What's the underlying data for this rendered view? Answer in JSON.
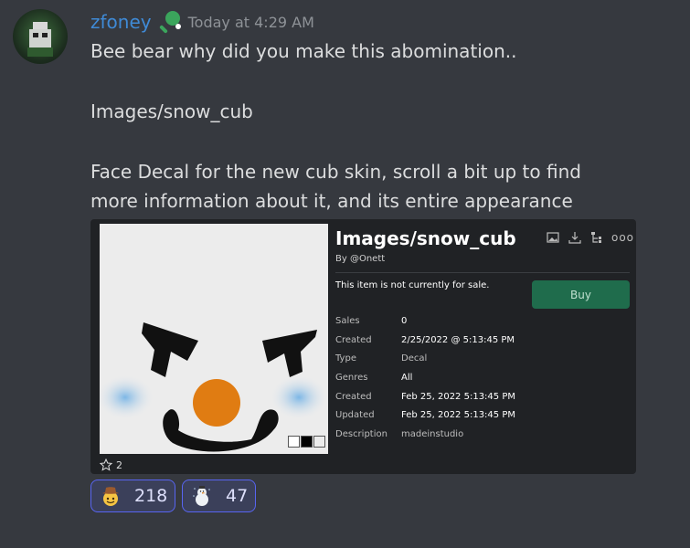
{
  "message": {
    "username": "zfoney",
    "timestamp": "Today at 4:29 AM",
    "lines": [
      "Bee bear why did you make this abomination..",
      "Images/snow_cub",
      "Face Decal for the new cub skin, scroll a bit up to find",
      "more information about it, and its entire appearance"
    ],
    "badge_icon": "ping-pong-paddle-icon",
    "colors": {
      "username": "#3f8ad6",
      "background": "#36393f",
      "text": "#dcddde",
      "timestamp": "#8e9297"
    }
  },
  "embed": {
    "title": "Images/snow_cub",
    "by": "By @Onett",
    "sale_note": "This item is not currently for sale.",
    "buy_label": "Buy",
    "details": [
      {
        "label": "Sales",
        "value": "0"
      },
      {
        "label": "Created",
        "value": "2/25/2022 @ 5:13:45 PM"
      },
      {
        "label": "Type",
        "value": "Decal"
      },
      {
        "label": "Genres",
        "value": "All"
      },
      {
        "label": "Created",
        "value": "Feb 25, 2022 5:13:45 PM"
      },
      {
        "label": "Updated",
        "value": "Feb 25, 2022 5:13:45 PM"
      },
      {
        "label": "Description",
        "value": "madeinstudio"
      }
    ],
    "tool_icons": [
      "image-icon",
      "download-icon",
      "hierarchy-icon",
      "more-icon"
    ],
    "more_label": "ooo",
    "star_count": "2",
    "colors": {
      "buy": "#1f6c4c",
      "embed_bg": "#202225"
    }
  },
  "reactions": [
    {
      "emoji": "cowboy-face-icon",
      "count": "218"
    },
    {
      "emoji": "snowman-icon",
      "count": "47"
    }
  ]
}
